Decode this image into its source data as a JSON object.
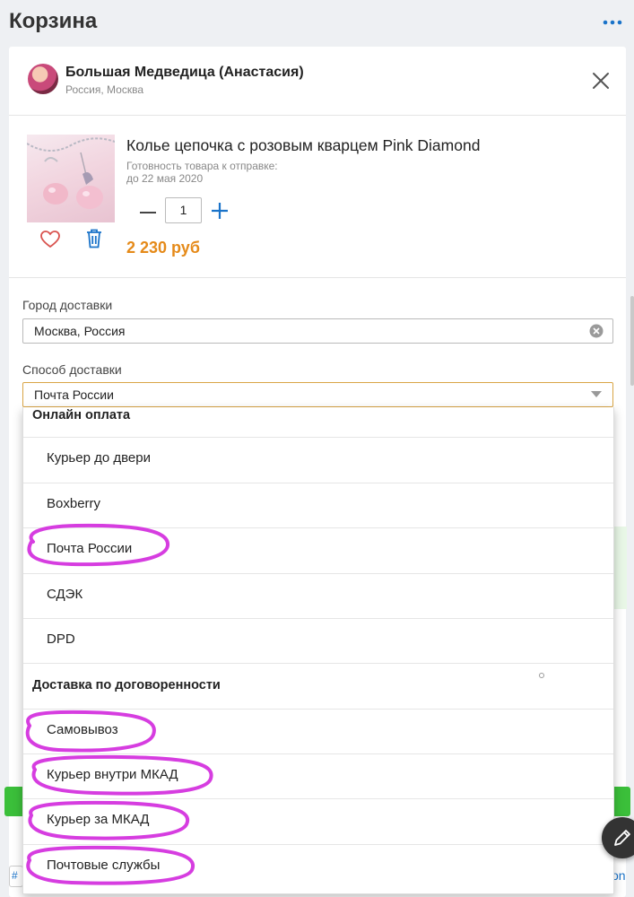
{
  "header": {
    "title": "Корзина",
    "more_icon": "more-dots-icon"
  },
  "seller": {
    "name": "Большая Медведица (Анастасия)",
    "location": "Россия, Москва"
  },
  "product": {
    "title": "Колье цепочка с розовым кварцем Pink Diamond",
    "ready_label": "Готовность товара к отправке:",
    "ready_date": "до 22 мая 2020",
    "quantity": "1",
    "price": "2 230 руб"
  },
  "delivery": {
    "city_label": "Город доставки",
    "city_value": "Москва, Россия",
    "method_label": "Способ доставки",
    "method_value": "Почта России"
  },
  "dropdown": {
    "groups": [
      {
        "title": "Онлайн оплата",
        "options": [
          "Курьер до двери",
          "Boxberry",
          "Почта России",
          "СДЭК",
          "DPD"
        ]
      },
      {
        "title": "Доставка по договоренности",
        "options": [
          "Самовывоз",
          "Курьер внутри МКАД",
          "Курьер за МКАД",
          "Почтовые службы"
        ]
      }
    ]
  },
  "background": {
    "partial_link": "on",
    "partial_chip": "#"
  },
  "colors": {
    "price": "#e58a19",
    "accent_blue": "#1a73c9",
    "highlight_marker": "#d63de0",
    "select_border": "#d9a545",
    "button_green": "#3bbf3a"
  }
}
